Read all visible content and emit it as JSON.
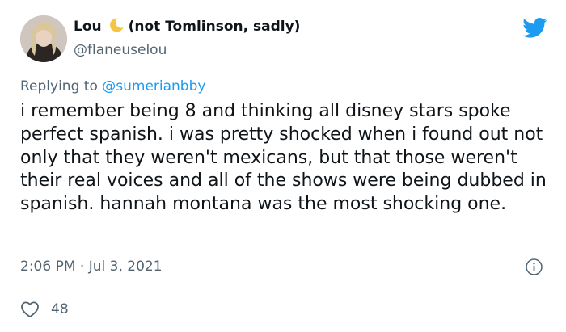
{
  "tweet": {
    "display_name": "Lou",
    "name_suffix": "(not Tomlinson, sadly)",
    "handle": "@flaneuselou",
    "reply_prefix": "Replying to",
    "reply_to": "@sumerianbby",
    "text": "i remember being 8 and thinking all disney stars spoke perfect spanish. i was pretty shocked when i found out not only that they weren't mexicans, but that those weren't their real voices and all of the shows were being dubbed in spanish. hannah montana was the most shocking one.",
    "time": "2:06 PM",
    "date": "Jul 3, 2021",
    "likes": "48"
  },
  "icons": {
    "brand": "twitter-bird-icon",
    "moon": "crescent-moon-emoji",
    "info": "info-icon",
    "like": "heart-icon"
  },
  "colors": {
    "brand_blue": "#1d9bf0",
    "text": "#0f1419",
    "secondary_text": "#536471",
    "divider": "#cfd9de"
  }
}
